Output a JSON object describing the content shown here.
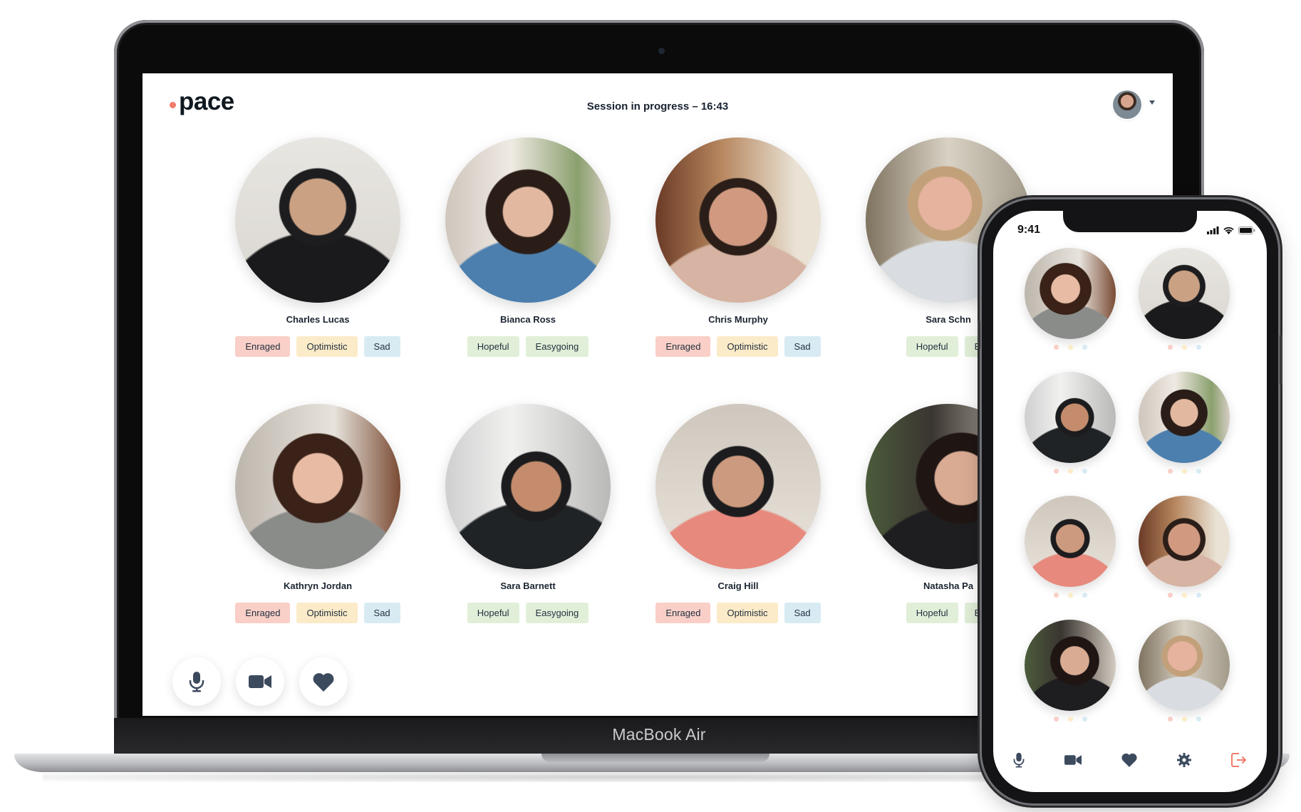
{
  "device_label": "MacBook Air",
  "app": {
    "logo": "pace",
    "session_status": "Session in progress – 16:43"
  },
  "participants": [
    {
      "name": "Charles Lucas",
      "tags": [
        {
          "label": "Enraged",
          "tone": "red"
        },
        {
          "label": "Optimistic",
          "tone": "yellow"
        },
        {
          "label": "Sad",
          "tone": "blue"
        }
      ]
    },
    {
      "name": "Bianca Ross",
      "tags": [
        {
          "label": "Hopeful",
          "tone": "green"
        },
        {
          "label": "Easygoing",
          "tone": "green"
        }
      ]
    },
    {
      "name": "Chris Murphy",
      "tags": [
        {
          "label": "Enraged",
          "tone": "red"
        },
        {
          "label": "Optimistic",
          "tone": "yellow"
        },
        {
          "label": "Sad",
          "tone": "blue"
        }
      ]
    },
    {
      "name": "Sara Schn",
      "tags": [
        {
          "label": "Hopeful",
          "tone": "green"
        },
        {
          "label": "E",
          "tone": "green"
        }
      ]
    },
    {
      "name": "Kathryn Jordan",
      "tags": [
        {
          "label": "Enraged",
          "tone": "red"
        },
        {
          "label": "Optimistic",
          "tone": "yellow"
        },
        {
          "label": "Sad",
          "tone": "blue"
        }
      ]
    },
    {
      "name": "Sara Barnett",
      "tags": [
        {
          "label": "Hopeful",
          "tone": "green"
        },
        {
          "label": "Easygoing",
          "tone": "green"
        }
      ]
    },
    {
      "name": "Craig Hill",
      "tags": [
        {
          "label": "Enraged",
          "tone": "red"
        },
        {
          "label": "Optimistic",
          "tone": "yellow"
        },
        {
          "label": "Sad",
          "tone": "blue"
        }
      ]
    },
    {
      "name": "Natasha Pa",
      "tags": [
        {
          "label": "Hopeful",
          "tone": "green"
        },
        {
          "label": "E",
          "tone": "green"
        }
      ]
    }
  ],
  "controls": [
    {
      "icon": "microphone-icon"
    },
    {
      "icon": "video-camera-icon"
    },
    {
      "icon": "heart-icon"
    }
  ],
  "phone": {
    "time": "9:41",
    "nav": [
      {
        "icon": "microphone-icon"
      },
      {
        "icon": "video-camera-icon"
      },
      {
        "icon": "heart-icon"
      },
      {
        "icon": "gear-icon"
      },
      {
        "icon": "exit-icon"
      }
    ]
  },
  "colors": {
    "accent": "#f07b6c",
    "tag_red": "#f9cfc7",
    "tag_yellow": "#fbebc8",
    "tag_blue": "#d8ebf3",
    "tag_green": "#e1efd8",
    "icon": "#3c4a5e"
  }
}
